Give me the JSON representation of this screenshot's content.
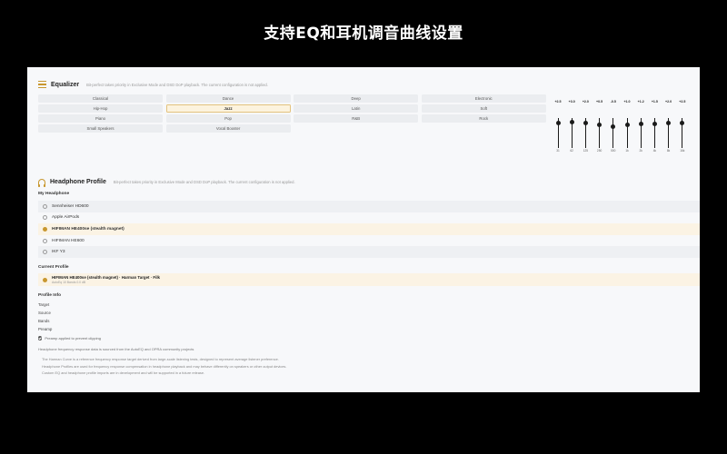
{
  "banner": {
    "title": "支持EQ和耳机调音曲线设置"
  },
  "equalizer": {
    "title": "Equalizer",
    "note": "Bit-perfect takes priority in Exclusive Mode and DSD DoP playback. The current configuration is not applied.",
    "presets": [
      {
        "label": "Classical",
        "active": false
      },
      {
        "label": "Dance",
        "active": false
      },
      {
        "label": "Deep",
        "active": false
      },
      {
        "label": "Electronic",
        "active": false
      },
      {
        "label": "Hip-Hop",
        "active": false
      },
      {
        "label": "Jazz",
        "active": true
      },
      {
        "label": "Latin",
        "active": false
      },
      {
        "label": "Soft",
        "active": false
      },
      {
        "label": "Piano",
        "active": false
      },
      {
        "label": "Pop",
        "active": false
      },
      {
        "label": "R&B",
        "active": false
      },
      {
        "label": "Rock",
        "active": false
      },
      {
        "label": "Small Speakers",
        "active": false
      },
      {
        "label": "Vocal Booster",
        "active": false
      }
    ],
    "bands": [
      {
        "freq": "31",
        "gain_label": "+2.5",
        "gain": 2.5
      },
      {
        "freq": "62",
        "gain_label": "+3.0",
        "gain": 3.0
      },
      {
        "freq": "125",
        "gain_label": "+2.0",
        "gain": 2.0
      },
      {
        "freq": "250",
        "gain_label": "+0.5",
        "gain": 0.5
      },
      {
        "freq": "500",
        "gain_label": "-0.5",
        "gain": -0.5
      },
      {
        "freq": "1k",
        "gain_label": "+1.0",
        "gain": 1.0
      },
      {
        "freq": "2k",
        "gain_label": "+1.2",
        "gain": 1.2
      },
      {
        "freq": "4k",
        "gain_label": "+1.5",
        "gain": 1.5
      },
      {
        "freq": "8k",
        "gain_label": "+2.0",
        "gain": 2.0
      },
      {
        "freq": "16k",
        "gain_label": "+2.5",
        "gain": 2.5
      }
    ],
    "gain_range": [
      -12,
      12
    ]
  },
  "headphone": {
    "title": "Headphone Profile",
    "note": "Bit-perfect takes priority in Exclusive Mode and DSD DoP playback. The current configuration is not applied.",
    "my_headphone_label": "My Headphone",
    "items": [
      {
        "label": "Sennheiser HD600",
        "selected": false
      },
      {
        "label": "Apple AirPods",
        "selected": false
      },
      {
        "label": "HIFIMAN HE400se (stealth magnet)",
        "selected": true
      },
      {
        "label": "HIFIMAN HE600",
        "selected": false
      },
      {
        "label": "IKF Y3",
        "selected": false
      }
    ],
    "current_profile_label": "Current Profile",
    "current_profile": {
      "name": "HIFIMAN HE400se (stealth magnet) · Harman Target · Filk",
      "details": "AutoEq  10 Bands  0.0 dB"
    },
    "profile_info_label": "Profile Info",
    "info_rows": [
      "Target",
      "Source",
      "Bands",
      "Preamp"
    ],
    "preamp_note": "Preamp applied to prevent clipping",
    "source_note": "Headphone frequency response data is sourced from the AutoEQ and OPRA community projects",
    "notes": [
      "The Harman Curve is a reference frequency response target derived from large-scale listening tests, designed to represent average listener preference.",
      "Headphone Profiles are used for frequency response compensation in headphone playback and may behave differently on speakers or other output devices.",
      "Custom EQ and headphone profile imports are in development and will be supported in a future release."
    ]
  }
}
